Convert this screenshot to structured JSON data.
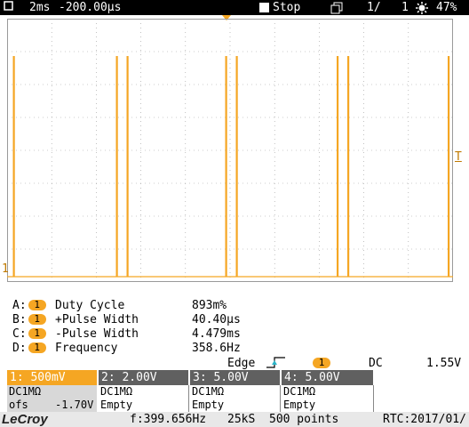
{
  "topbar": {
    "timebase": "2ms",
    "delay": "-200.00µs",
    "run_state": "Stop",
    "sequence": "1/",
    "sequence_count": "1",
    "battery": "47%"
  },
  "colors": {
    "trace": "#f5a623",
    "grid": "#9a9a9a",
    "channel1_tab": "#f5a623",
    "channel_tab": "#606060"
  },
  "markers": {
    "trigger_level": "T",
    "channel_ground": "1"
  },
  "measurements": [
    {
      "slot": "A:",
      "channel": "1",
      "name": "Duty Cycle",
      "value": "893m%"
    },
    {
      "slot": "B:",
      "channel": "1",
      "name": "+Pulse Width",
      "value": "40.40µs"
    },
    {
      "slot": "C:",
      "channel": "1",
      "name": "-Pulse Width",
      "value": "4.479ms"
    },
    {
      "slot": "D:",
      "channel": "1",
      "name": "Frequency",
      "value": "358.6Hz"
    }
  ],
  "trigger": {
    "mode": "Edge",
    "source": "1",
    "coupling": "DC",
    "level": "1.55V"
  },
  "channels": [
    {
      "label": "1: 500mV",
      "coupling": "DC1MΩ",
      "offset_label": "ofs",
      "offset_value": "-1.70V"
    },
    {
      "label": "2: 2.00V",
      "coupling": "DC1MΩ",
      "status": "Empty"
    },
    {
      "label": "3: 5.00V",
      "coupling": "DC1MΩ",
      "status": "Empty"
    },
    {
      "label": "4: 5.00V",
      "coupling": "DC1MΩ",
      "status": "Empty"
    }
  ],
  "bottombar": {
    "brand": "LeCroy",
    "frequency": "f:399.656Hz",
    "sample_rate": "25kS",
    "points": "500 points",
    "rtc": "RTC:2017/01/"
  },
  "waveform": {
    "channel": "1",
    "pulse_times_div": [
      0.15,
      2.46,
      2.7,
      4.91,
      5.15,
      7.41,
      7.65,
      9.9
    ],
    "divisions": 10
  }
}
